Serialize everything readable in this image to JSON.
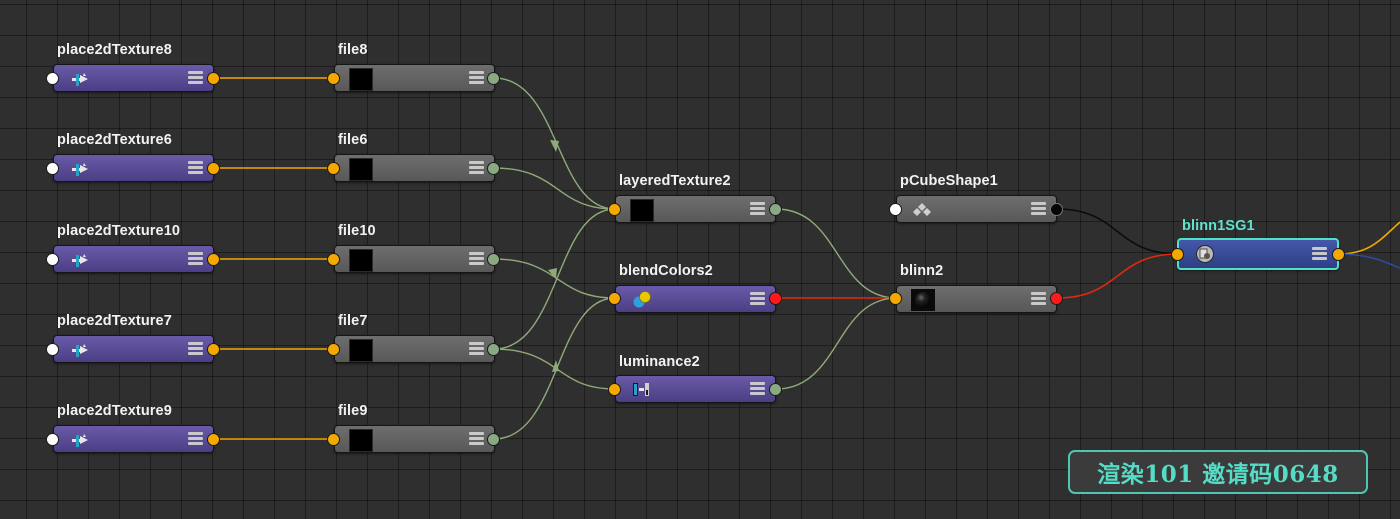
{
  "editor": {
    "nodes": {
      "place2dTexture8": {
        "title": "place2dTexture8",
        "icon": "place2d-icon"
      },
      "place2dTexture6": {
        "title": "place2dTexture6",
        "icon": "place2d-icon"
      },
      "place2dTexture10": {
        "title": "place2dTexture10",
        "icon": "place2d-icon"
      },
      "place2dTexture7": {
        "title": "place2dTexture7",
        "icon": "place2d-icon"
      },
      "place2dTexture9": {
        "title": "place2dTexture9",
        "icon": "place2d-icon"
      },
      "file8": {
        "title": "file8",
        "icon": "black-swatch"
      },
      "file6": {
        "title": "file6",
        "icon": "black-swatch"
      },
      "file10": {
        "title": "file10",
        "icon": "black-swatch"
      },
      "file7": {
        "title": "file7",
        "icon": "black-swatch"
      },
      "file9": {
        "title": "file9",
        "icon": "black-swatch"
      },
      "layeredTexture2": {
        "title": "layeredTexture2",
        "icon": "black-swatch"
      },
      "blendColors2": {
        "title": "blendColors2",
        "icon": "blend-colors-icon"
      },
      "luminance2": {
        "title": "luminance2",
        "icon": "luminance-icon"
      },
      "pCubeShape1": {
        "title": "pCubeShape1",
        "icon": "mesh-icon"
      },
      "blinn2": {
        "title": "blinn2",
        "icon": "blinn-sphere-icon"
      },
      "blinn1SG1": {
        "title": "blinn1SG1",
        "icon": "shading-group-icon"
      }
    },
    "wire_colors": {
      "uv": "#f0a800",
      "color": "#8faa7a",
      "shader": "#dd2a10",
      "geometry": "#0b0b0b",
      "offscreen_out": "#f5a800",
      "offscreen_out_2": "#2e4aa0"
    }
  },
  "watermark": {
    "text": "渲染101 邀请码0648"
  }
}
